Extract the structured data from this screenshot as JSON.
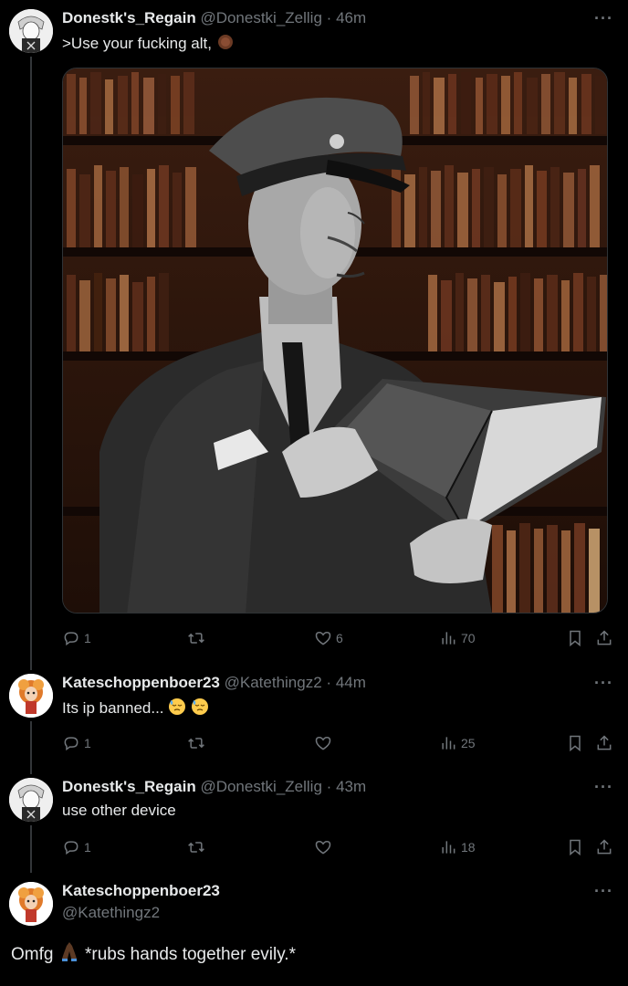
{
  "tweets": [
    {
      "name": "Donestk's_Regain",
      "handle": "@Donestki_Zellig",
      "time": "46m",
      "text": ">Use your fucking alt,",
      "replies": "1",
      "retweets": "",
      "likes": "6",
      "views": "70"
    },
    {
      "name": "Kateschoppenboer23",
      "handle": "@Katethingz2",
      "time": "44m",
      "text": "Its ip banned...",
      "replies": "1",
      "retweets": "",
      "likes": "",
      "views": "25"
    },
    {
      "name": "Donestk's_Regain",
      "handle": "@Donestki_Zellig",
      "time": "43m",
      "text": "use other device",
      "replies": "1",
      "retweets": "",
      "likes": "",
      "views": "18"
    }
  ],
  "main_tweet": {
    "name": "Kateschoppenboer23",
    "handle": "@Katethingz2",
    "text_before": "Omfg",
    "text_after": "*rubs hands together evily.*"
  },
  "separator": "·",
  "more_label": "···",
  "colors": {
    "background": "#000000",
    "text": "#e7e9ea",
    "muted": "#71767b"
  }
}
